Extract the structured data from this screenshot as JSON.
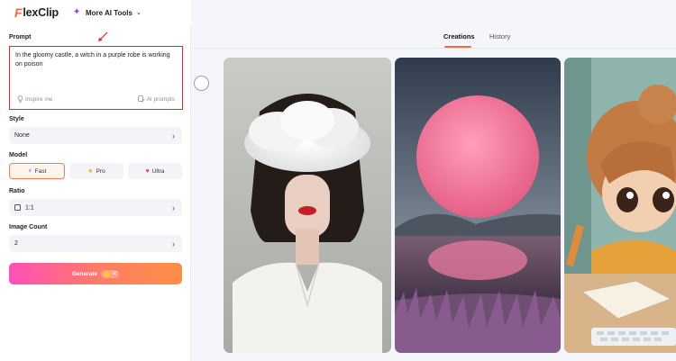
{
  "header": {
    "logo_text": "FlexClip",
    "logo_f": "F",
    "logo_rest": "lexClip",
    "more_tools_label": "More AI Tools"
  },
  "left_panel": {
    "prompt_label": "Prompt",
    "prompt_value": "In the gloomy castle, a witch in a purple robe is working on poison",
    "inspire_label": "Inspire me",
    "ai_prompts_label": "AI prompts",
    "style_label": "Style",
    "style_value": "None",
    "model_label": "Model",
    "models": [
      {
        "label": "Fast",
        "icon": "lightning-icon",
        "selected": true
      },
      {
        "label": "Pro",
        "icon": "star-icon",
        "selected": false
      },
      {
        "label": "Ultra",
        "icon": "heart-gem-icon",
        "selected": false
      }
    ],
    "ratio_label": "Ratio",
    "ratio_value": "1:1",
    "image_count_label": "Image Count",
    "image_count_value": "2",
    "generate_label": "Generate",
    "generate_cost": "-2"
  },
  "right_panel": {
    "tabs": [
      "Creations",
      "History"
    ],
    "active_tab": "Creations",
    "images": [
      {
        "name": "cloud-head-woman-image"
      },
      {
        "name": "pink-moon-lake-image"
      },
      {
        "name": "cartoon-girl-writing-image"
      }
    ]
  },
  "colors": {
    "accent": "#ff6a3d",
    "highlight_border": "#e02a2a",
    "generate_gradient_start": "#ff4fb8",
    "generate_gradient_end": "#ff8f47"
  }
}
